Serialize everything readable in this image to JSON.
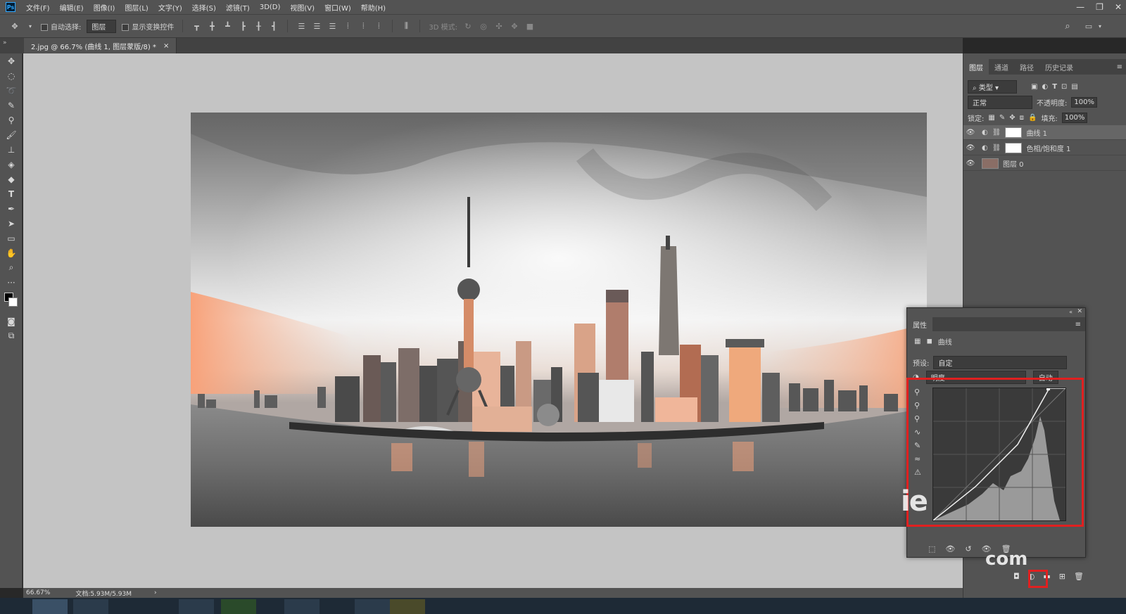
{
  "app": {
    "logo": "Ps"
  },
  "menu": [
    "文件(F)",
    "编辑(E)",
    "图像(I)",
    "图层(L)",
    "文字(Y)",
    "选择(S)",
    "滤镜(T)",
    "3D(D)",
    "视图(V)",
    "窗口(W)",
    "帮助(H)"
  ],
  "window_controls": {
    "minimize": "—",
    "restore": "❐",
    "close": "✕"
  },
  "options": {
    "auto_select_label": "自动选择:",
    "auto_select_value": "图层",
    "show_transform_label": "显示变换控件",
    "mode_3d_label": "3D 模式:"
  },
  "document": {
    "tab_title": "2.jpg @ 66.7% (曲线 1, 图层蒙版/8) *",
    "tab_close": "×"
  },
  "status": {
    "zoom": "66.67%",
    "doc_size": "文档:5.93M/5.93M",
    "arrow": "›"
  },
  "layers_panel": {
    "tabs": [
      "图层",
      "通道",
      "路径",
      "历史记录"
    ],
    "filter_label": "类型",
    "blend_mode": "正常",
    "opacity_label": "不透明度:",
    "opacity_value": "100%",
    "lock_label": "锁定:",
    "fill_label": "填充:",
    "fill_value": "100%",
    "layers": [
      {
        "name": "曲线 1",
        "selected": true
      },
      {
        "name": "色相/饱和度 1",
        "selected": false
      },
      {
        "name": "图层 0",
        "selected": false
      }
    ]
  },
  "properties_panel": {
    "title": "属性",
    "type_label": "曲线",
    "preset_label": "预设:",
    "preset_value": "自定",
    "channel_value": "明度",
    "auto_button": "自动"
  },
  "watermark": {
    "text1": "ie",
    "text2": "com"
  },
  "colors": {
    "accent_highlight": "#e02020",
    "panel_bg": "#535353",
    "canvas_bg": "#c4c4c4"
  }
}
